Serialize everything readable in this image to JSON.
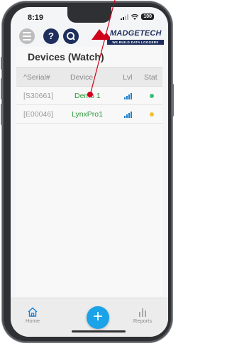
{
  "status_bar": {
    "time": "8:19",
    "battery": "100"
  },
  "app_bar": {
    "help_label": "?",
    "logo_name": "MADGETECH",
    "logo_tagline": "WE BUILD DATA LOGGERS"
  },
  "page": {
    "title": "Devices (Watch)"
  },
  "table": {
    "headers": {
      "serial": "^Serial#",
      "device": "Device",
      "level": "Lvl",
      "status": "Stat"
    },
    "rows": [
      {
        "serial": "[S30661]",
        "device": "Demo 1",
        "signal_level": 4,
        "status_color": "#3dbf7a"
      },
      {
        "serial": "[E00046]",
        "device": "LynxPro1",
        "signal_level": 4,
        "status_color": "#f2c12e"
      }
    ]
  },
  "bottom_nav": {
    "home_label": "Home",
    "add_label": "+",
    "reports_label": "Reports"
  },
  "colors": {
    "brand_navy": "#1e2f5e",
    "accent_blue": "#1aa3e8",
    "annotation_red": "#d0021b"
  }
}
